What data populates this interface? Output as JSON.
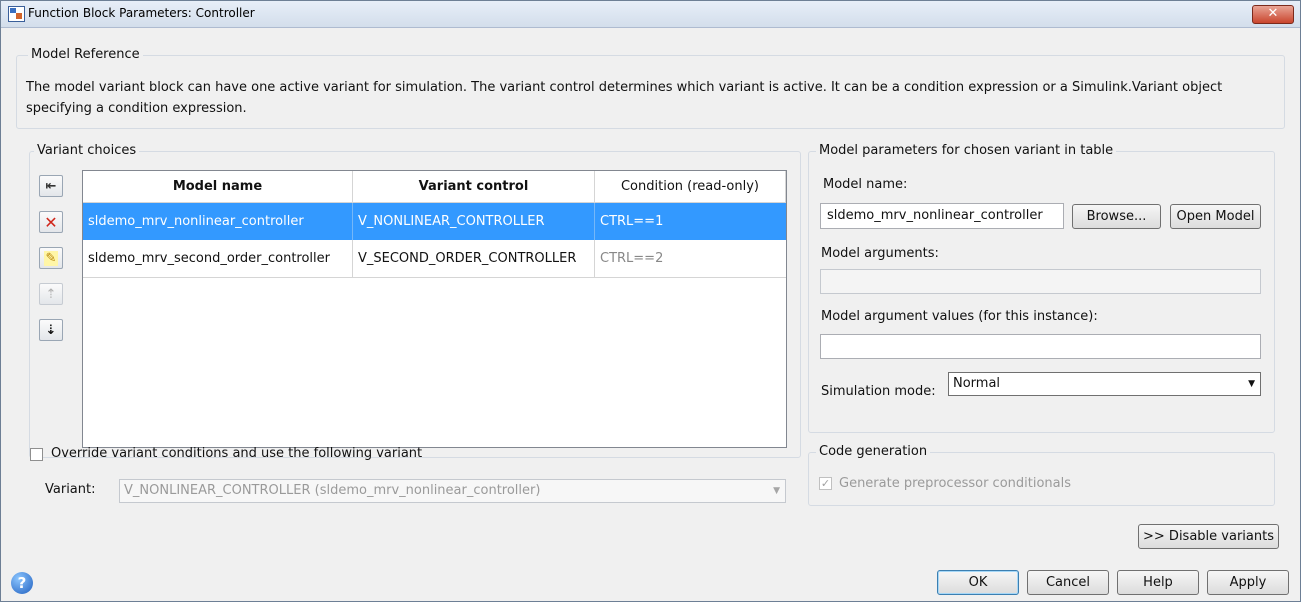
{
  "window": {
    "title": "Function Block Parameters: Controller",
    "close_glyph": "✕"
  },
  "model_reference": {
    "group_label": "Model Reference",
    "description": "The model variant block can have one active variant for simulation. The variant control determines which variant is active. It can be a condition expression or a Simulink.Variant object specifying a condition expression."
  },
  "variant_choices": {
    "group_label": "Variant choices",
    "toolbar": [
      {
        "icon": "add-icon",
        "glyph": "⇤"
      },
      {
        "icon": "delete-icon",
        "glyph": "✕"
      },
      {
        "icon": "edit-icon",
        "glyph": "✎"
      },
      {
        "icon": "move-up-icon",
        "glyph": "⇡"
      },
      {
        "icon": "move-down-icon",
        "glyph": "⇣"
      }
    ],
    "columns": [
      "Model name",
      "Variant control",
      "Condition (read-only)"
    ],
    "rows": [
      {
        "model_name": "sldemo_mrv_nonlinear_controller",
        "variant_control": "V_NONLINEAR_CONTROLLER",
        "condition": "CTRL==1",
        "selected": true
      },
      {
        "model_name": "sldemo_mrv_second_order_controller",
        "variant_control": "V_SECOND_ORDER_CONTROLLER",
        "condition": "CTRL==2",
        "selected": false
      }
    ]
  },
  "override": {
    "checkbox_label": "Override variant conditions and use the following variant",
    "checked": false,
    "variant_label": "Variant:",
    "variant_value": "V_NONLINEAR_CONTROLLER (sldemo_mrv_nonlinear_controller)"
  },
  "model_params": {
    "group_label": "Model parameters for chosen variant in table",
    "model_name_label": "Model name:",
    "model_name_value": "sldemo_mrv_nonlinear_controller",
    "browse_label": "Browse...",
    "open_model_label": "Open Model",
    "model_arguments_label": "Model arguments:",
    "model_arguments_value": "",
    "model_argument_values_label": "Model argument values (for this instance):",
    "model_argument_values_value": "",
    "simulation_mode_label": "Simulation mode:",
    "simulation_mode_value": "Normal"
  },
  "code_generation": {
    "group_label": "Code generation",
    "checkbox_label": "Generate preprocessor conditionals",
    "checked": true,
    "check_glyph": "✓"
  },
  "disable_variants_label": ">> Disable variants",
  "footer": {
    "help_glyph": "?",
    "ok_label": "OK",
    "cancel_label": "Cancel",
    "help_label": "Help",
    "apply_label": "Apply"
  },
  "colors": {
    "selection": "#3399ff",
    "close_button": "#c9452d"
  }
}
